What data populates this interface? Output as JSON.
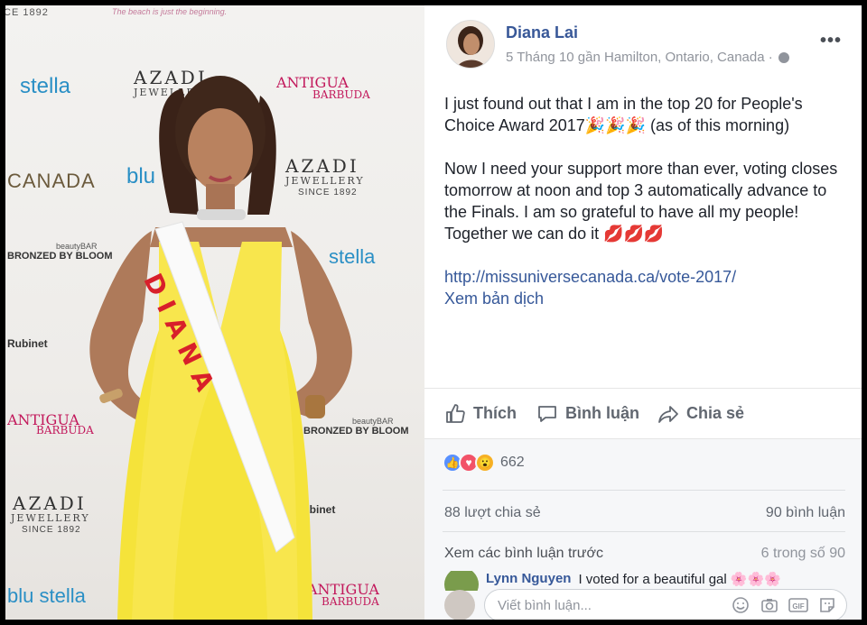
{
  "photo": {
    "sash_text": "DIANA",
    "logos": {
      "since_1892": "CE 1892",
      "slogan_top": "The beach is just the beginning.",
      "stella": "stella",
      "azadi": "AZADI",
      "jewellery": "JEWELLERY",
      "since": "SINCE",
      "antigua": "ANTIGUA",
      "barbuda": "BARBUDA",
      "canada": "CANADA",
      "blu": "blu",
      "bronzed": "BRONZED BY BLOOM",
      "beautybar": "beautyBAR",
      "rubinet": "Rubinet",
      "bubinet": "bubinet",
      "since_full": "SINCE 1892",
      "bronzed_small": "BRONZED BY BLOOM",
      "blu_stella": "blu stella",
      "slogan": "The beach is just the beginning."
    }
  },
  "post": {
    "author": "Diana Lai",
    "meta": "5 Tháng 10 gần Hamilton, Ontario, Canada ·",
    "text1": "I just found out that I am in the top 20 for People's Choice Award 2017🎉🎉🎉 (as of this morning)",
    "text2": "Now I need your support more than ever, voting closes tomorrow at noon and top 3 automatically advance to the Finals. I am so grateful to have all my people! Together we can do it 💋💋💋",
    "link": "http://missuniversecanada.ca/vote-2017/",
    "translate": "Xem bản dịch"
  },
  "actions": {
    "like": "Thích",
    "comment": "Bình luận",
    "share": "Chia sẻ"
  },
  "stats": {
    "reaction_count": "662",
    "shares": "88 lượt chia sẻ",
    "comments": "90 bình luận",
    "prev_comments": "Xem các bình luận trước",
    "comment_count": "6 trong số 90"
  },
  "comment": {
    "name": "Lynn Nguyen",
    "text": "I voted for a beautiful gal 🌸🌸🌸"
  },
  "compose": {
    "placeholder": "Viết bình luận..."
  },
  "colors": {
    "link": "#365899",
    "author": "#385898",
    "dress": "#f5e33a",
    "sash_text": "#d81f2a"
  }
}
